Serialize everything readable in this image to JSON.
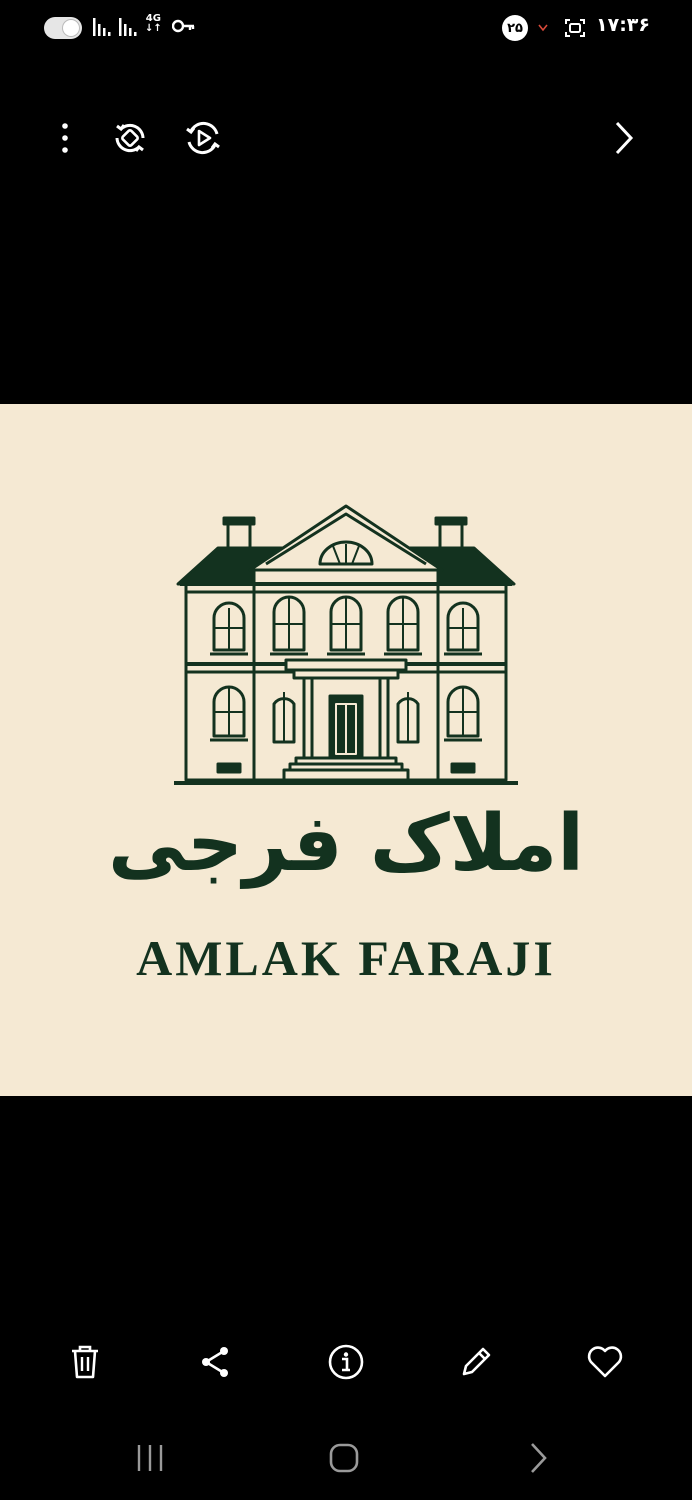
{
  "status_bar": {
    "network_type": "4G",
    "badge": "۲۵",
    "time": "۱۷:۳۶"
  },
  "toolbar_top": {
    "icons": [
      "more-options-icon",
      "rotate-icon",
      "remaster-icon",
      "next-icon"
    ]
  },
  "image": {
    "background_color": "#f5e9d3",
    "ink_color": "#13321f",
    "logo_text_fa": "املاک فرجی",
    "logo_text_en": "AMLAK FARAJI"
  },
  "toolbar_bottom": {
    "icons": [
      "delete-icon",
      "share-icon",
      "info-icon",
      "edit-icon",
      "favorite-icon"
    ]
  },
  "nav_bar": {
    "icons": [
      "recents-icon",
      "home-icon",
      "back-icon"
    ]
  }
}
